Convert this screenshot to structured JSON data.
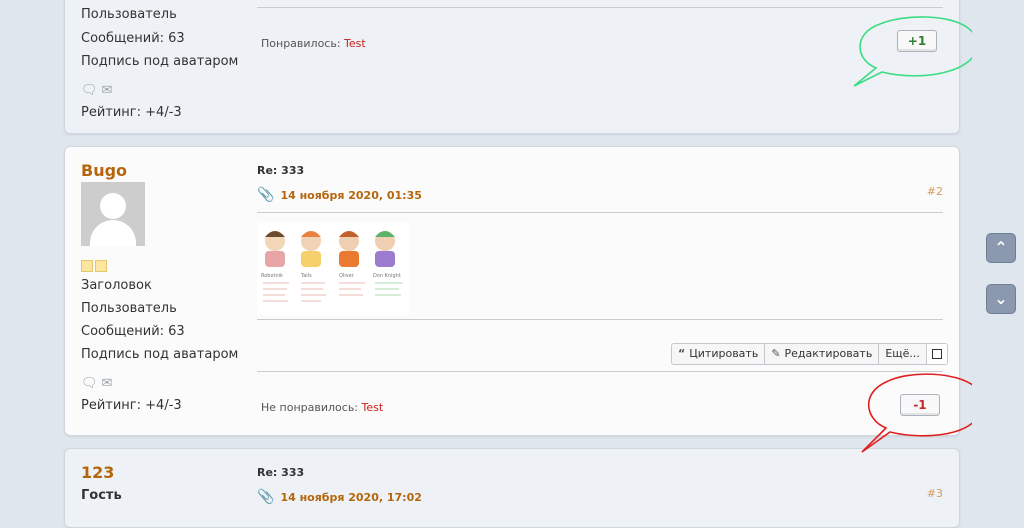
{
  "posts": [
    {
      "role": "Пользователь",
      "messages": "Сообщений: 63",
      "signature": "Подпись под аватаром",
      "rating": "Рейтинг: +4/-3",
      "likes_label": "Понравилось:",
      "likes_user": "Test",
      "vote": "+1"
    },
    {
      "author": "Bugo",
      "title": "Заголовок",
      "role": "Пользователь",
      "messages": "Сообщений: 63",
      "signature": "Подпись под аватаром",
      "rating": "Рейтинг: +4/-3",
      "subject": "Re: 333",
      "date": "14 ноября 2020, 01:35",
      "number": "#2",
      "quote_label": "Цитировать",
      "edit_label": "Редактировать",
      "more_label": "Ещё...",
      "likes_label": "Не понравилось:",
      "likes_user": "Test",
      "vote": "-1"
    },
    {
      "author": "123",
      "role": "Гость",
      "subject": "Re: 333",
      "date": "14 ноября 2020, 17:02",
      "number": "#3"
    }
  ],
  "image_characters": [
    "Robotnik",
    "Tails",
    "Oliver",
    "Don Knight"
  ],
  "icons": {
    "quote": "quote-icon",
    "edit": "edit-icon",
    "attachment": "paperclip-icon",
    "pm": "envelope-icon",
    "chat": "speech-bubble-icon",
    "up": "chevron-up-icon",
    "down": "chevron-down-icon"
  },
  "colors": {
    "author": "#b5660d",
    "like_user": "#c8211d",
    "positive": "#2e7d32",
    "negative": "#c62828",
    "bubble_positive": "#3ddc84",
    "bubble_negative": "#e02020"
  }
}
